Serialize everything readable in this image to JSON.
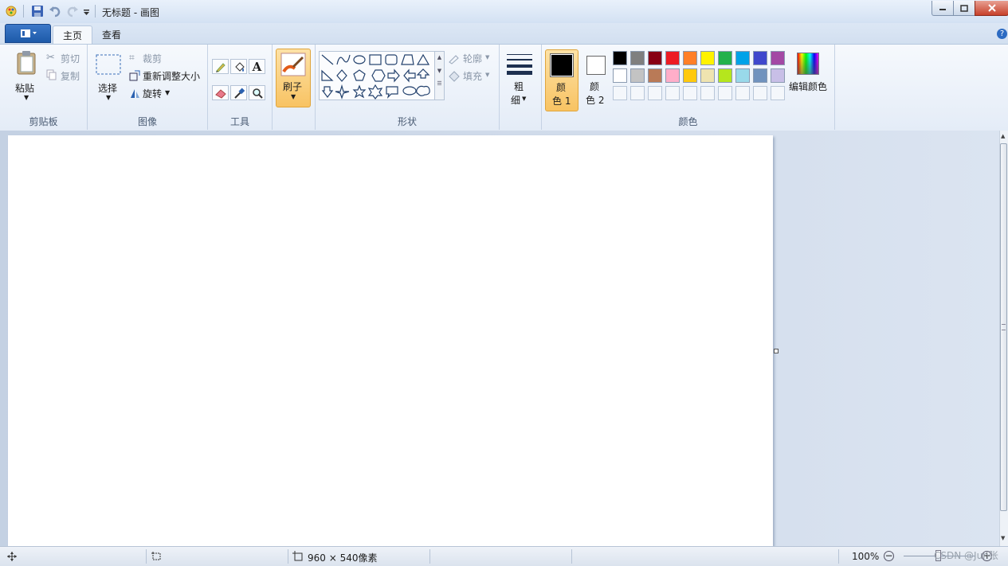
{
  "window": {
    "title": "无标题 - 画图"
  },
  "ribbon_tabs": {
    "home": "主页",
    "view": "查看"
  },
  "clipboard": {
    "paste": "粘贴",
    "cut": "剪切",
    "copy": "复制",
    "group": "剪贴板"
  },
  "image": {
    "select": "选择",
    "crop": "裁剪",
    "resize": "重新调整大小",
    "rotate": "旋转",
    "group": "图像"
  },
  "tools": {
    "group": "工具"
  },
  "brushes": {
    "label": "刷子"
  },
  "shapes": {
    "outline": "轮廓",
    "fill": "填充",
    "group": "形状"
  },
  "size": {
    "label_line1": "粗",
    "label_line2": "细"
  },
  "colors": {
    "color1_line1": "颜",
    "color1_line2": "色 1",
    "color2_line1": "颜",
    "color2_line2": "色 2",
    "edit": "编辑颜色",
    "group": "颜色",
    "color1_value": "#000000",
    "color2_value": "#ffffff",
    "palette_row1": [
      "#000000",
      "#7f7f7f",
      "#880015",
      "#ed1c24",
      "#ff7f27",
      "#fff200",
      "#22b14c",
      "#00a2e8",
      "#3f48cc",
      "#a349a4"
    ],
    "palette_row2": [
      "#ffffff",
      "#c3c3c3",
      "#b97a57",
      "#ffaec9",
      "#ffc90e",
      "#efe4b0",
      "#b5e61d",
      "#99d9ea",
      "#7092be",
      "#c8bfe7"
    ]
  },
  "status": {
    "size": "960 × 540像素",
    "zoom": "100%"
  },
  "watermark": "CSDN @Jun张"
}
